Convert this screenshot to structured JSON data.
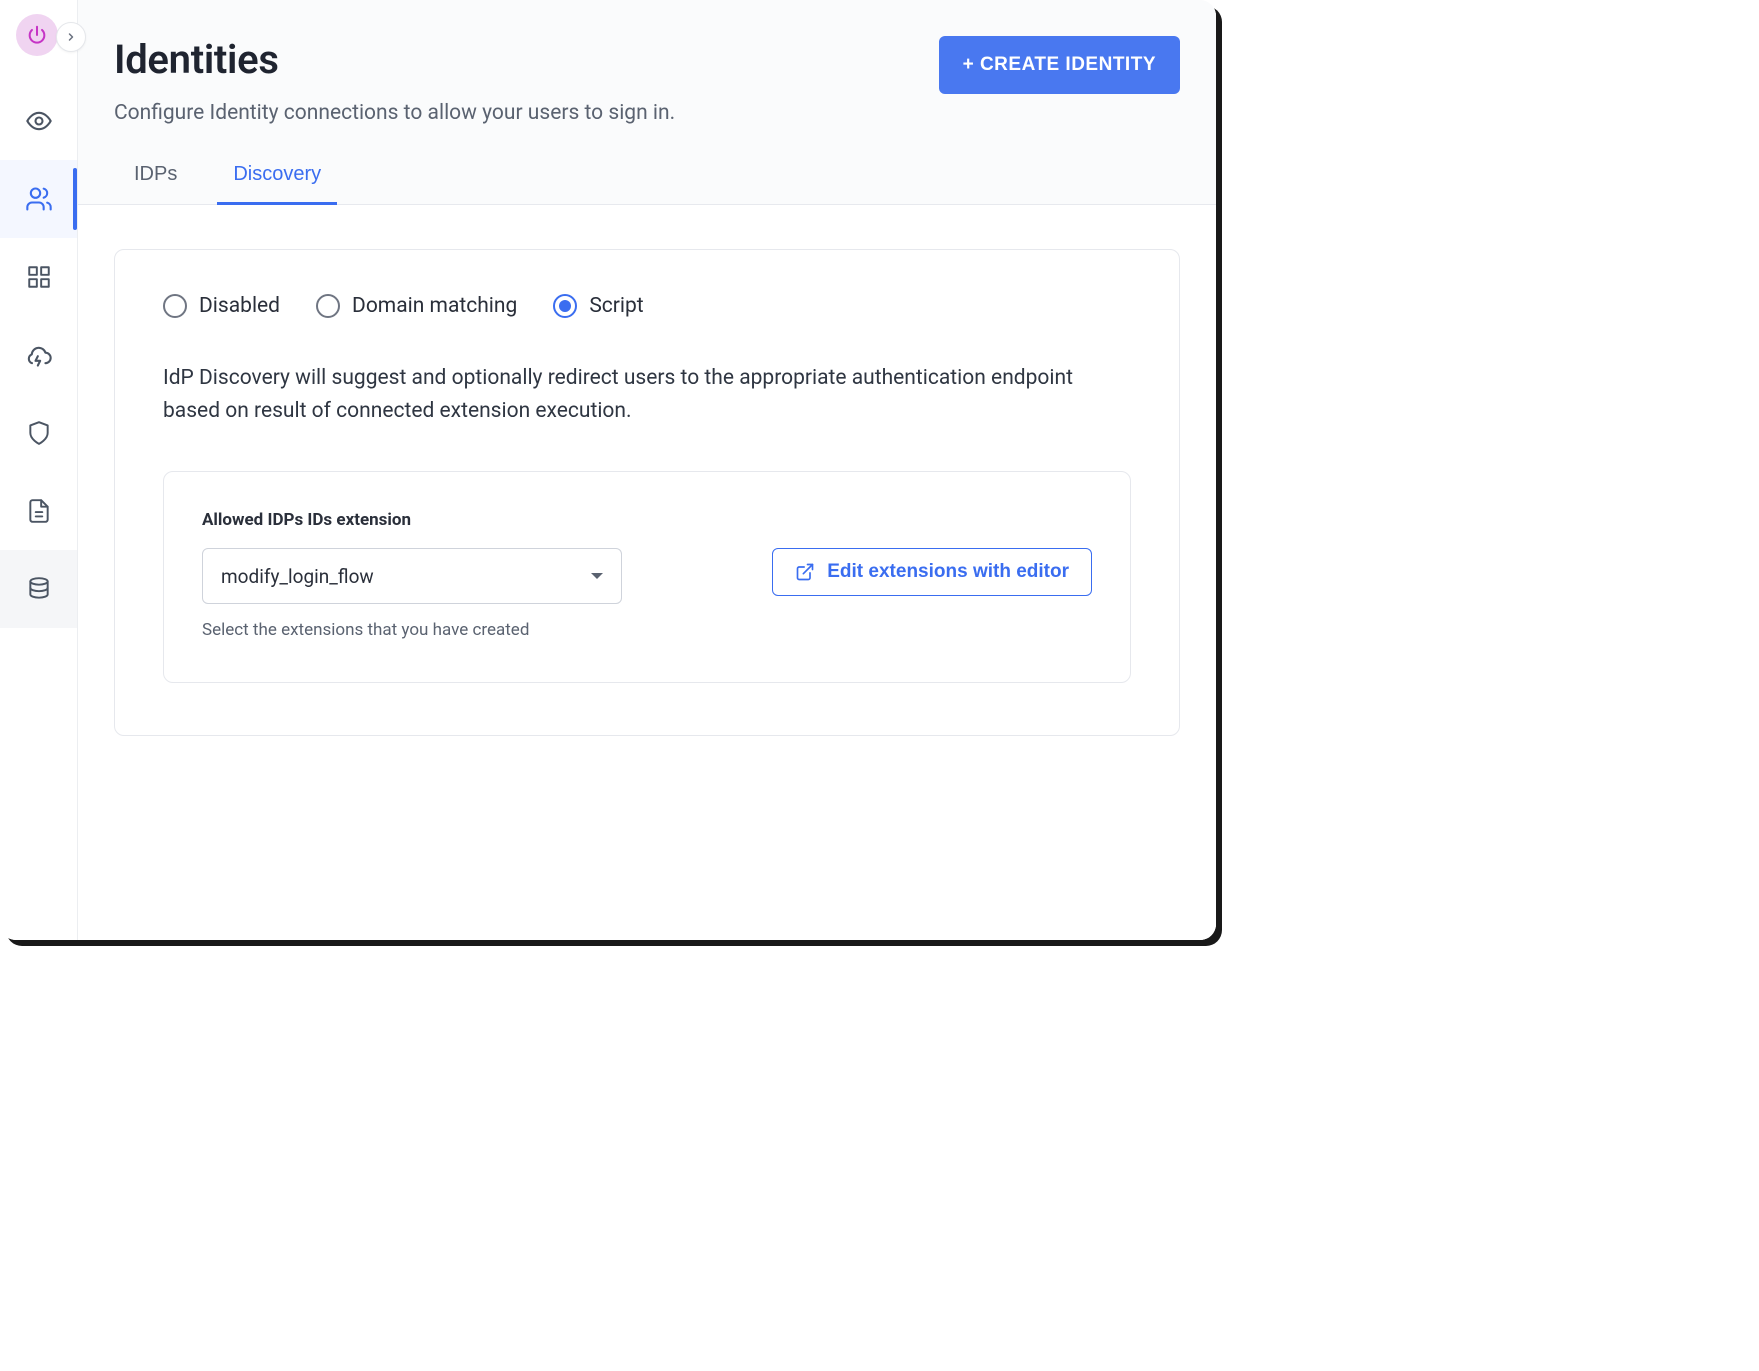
{
  "sidebar": {
    "logo_icon": "power-icon",
    "expand_label": "expand",
    "items": [
      {
        "name": "overview",
        "icon": "eye",
        "active": false
      },
      {
        "name": "identities",
        "icon": "users",
        "active": true
      },
      {
        "name": "apps",
        "icon": "grid",
        "active": false
      },
      {
        "name": "events",
        "icon": "cloud",
        "active": false
      },
      {
        "name": "security",
        "icon": "shield",
        "active": false
      },
      {
        "name": "docs",
        "icon": "file",
        "active": false
      },
      {
        "name": "data",
        "icon": "database",
        "active": false
      }
    ]
  },
  "header": {
    "title": "Identities",
    "subtitle": "Configure Identity connections to allow your users to sign in.",
    "create_button": "+ CREATE IDENTITY"
  },
  "tabs": [
    {
      "label": "IDPs",
      "active": false
    },
    {
      "label": "Discovery",
      "active": true
    }
  ],
  "discovery": {
    "options": [
      {
        "label": "Disabled",
        "selected": false
      },
      {
        "label": "Domain matching",
        "selected": false
      },
      {
        "label": "Script",
        "selected": true
      }
    ],
    "description": "IdP Discovery will suggest and optionally redirect users to the appropriate authentication endpoint based on result of connected extension execution.",
    "extension_panel": {
      "field_label": "Allowed IDPs IDs extension",
      "selected_value": "modify_login_flow",
      "help_text": "Select the extensions that you have created",
      "edit_button": "Edit extensions with editor"
    }
  }
}
